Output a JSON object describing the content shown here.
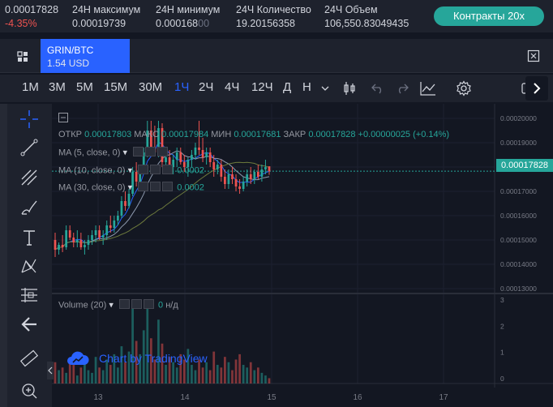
{
  "ticker": {
    "last_price": "0.00017828",
    "change_pct": "-4.35%",
    "high_label": "24Н максимум",
    "high_value": "0.00019739",
    "low_label": "24Н минимум",
    "low_value_main": "0.000168",
    "low_value_faded": "00",
    "count_label": "24Ч Количество",
    "count_value": "19.20156358",
    "volume_label": "24Ч Объем",
    "volume_value": "106,550.83049435",
    "contracts_button": "Контракты 20x"
  },
  "symbol": {
    "name": "GRIN/BTC",
    "price": "1.54 USD"
  },
  "toolbar": {
    "timeframes": [
      "1M",
      "3M",
      "5M",
      "15M",
      "30M",
      "1Ч",
      "2Ч",
      "4Ч",
      "12Ч",
      "Д",
      "Н"
    ],
    "active_timeframe": "1Ч"
  },
  "legend": {
    "open_label": "ОТКР",
    "open_value": "0.00017803",
    "high_label": "МАКС",
    "high_value": "0.00017984",
    "low_label": "МИН",
    "low_value": "0.00017681",
    "close_label": "ЗАКР",
    "close_value": "0.00017828",
    "change": "+0.00000025 (+0.14%)",
    "ma5": "MA (5, close, 0)",
    "ma10": "MA (10, close, 0)",
    "ma10_value": "0.0002",
    "ma30": "MA (30, close, 0)",
    "ma30_value": "0.0002",
    "volume": "Volume (20)",
    "volume_value": "0",
    "volume_na": "н/д"
  },
  "price_axis": {
    "labels": [
      "0.00020000",
      "0.00019000",
      "0.00018000",
      "0.00017000",
      "0.00016000",
      "0.00015000",
      "0.00014000",
      "0.00013000"
    ],
    "current_price_tag": "0.00017828"
  },
  "volume_axis": {
    "labels": [
      "3",
      "2",
      "1",
      "0"
    ]
  },
  "time_axis": {
    "labels": [
      "13",
      "14",
      "15",
      "16",
      "17"
    ]
  },
  "watermark": "Chart by TradingView",
  "colors": {
    "bg": "#131722",
    "panel": "#1e222d",
    "up": "#26a69a",
    "down": "#ef5350",
    "accent": "#2962ff",
    "ma5": "#2962ff",
    "ma10": "#8e9aaf",
    "ma30": "#6d7a3d"
  },
  "chart_data": {
    "type": "candlestick",
    "x_axis_label_values": [
      "13",
      "14",
      "15",
      "16",
      "17"
    ],
    "ylim": [
      0.000128,
      0.000206
    ],
    "candles": [
      {
        "o": 0.00015,
        "h": 0.000153,
        "l": 0.000143,
        "c": 0.000146
      },
      {
        "o": 0.000146,
        "h": 0.000149,
        "l": 0.000144,
        "c": 0.000148
      },
      {
        "o": 0.000148,
        "h": 0.000152,
        "l": 0.000145,
        "c": 0.000147
      },
      {
        "o": 0.000147,
        "h": 0.000156,
        "l": 0.000146,
        "c": 0.000154
      },
      {
        "o": 0.000154,
        "h": 0.000156,
        "l": 0.00015,
        "c": 0.000151
      },
      {
        "o": 0.000151,
        "h": 0.000153,
        "l": 0.000147,
        "c": 0.000149
      },
      {
        "o": 0.000149,
        "h": 0.000154,
        "l": 0.000147,
        "c": 0.00015
      },
      {
        "o": 0.00015,
        "h": 0.000153,
        "l": 0.000146,
        "c": 0.000147
      },
      {
        "o": 0.000147,
        "h": 0.00015,
        "l": 0.000144,
        "c": 0.000148
      },
      {
        "o": 0.000148,
        "h": 0.000152,
        "l": 0.000146,
        "c": 0.00015
      },
      {
        "o": 0.00015,
        "h": 0.000154,
        "l": 0.000148,
        "c": 0.000152
      },
      {
        "o": 0.000152,
        "h": 0.000156,
        "l": 0.000149,
        "c": 0.000154
      },
      {
        "o": 0.000154,
        "h": 0.000156,
        "l": 0.00015,
        "c": 0.000151
      },
      {
        "o": 0.000151,
        "h": 0.000154,
        "l": 0.000148,
        "c": 0.000152
      },
      {
        "o": 0.000152,
        "h": 0.000158,
        "l": 0.00015,
        "c": 0.000156
      },
      {
        "o": 0.000156,
        "h": 0.00016,
        "l": 0.000153,
        "c": 0.000155
      },
      {
        "o": 0.000155,
        "h": 0.00016,
        "l": 0.000153,
        "c": 0.000158
      },
      {
        "o": 0.000158,
        "h": 0.000162,
        "l": 0.000156,
        "c": 0.00016
      },
      {
        "o": 0.00016,
        "h": 0.000168,
        "l": 0.000159,
        "c": 0.000166
      },
      {
        "o": 0.000166,
        "h": 0.00017,
        "l": 0.000162,
        "c": 0.000164
      },
      {
        "o": 0.000164,
        "h": 0.000171,
        "l": 0.000163,
        "c": 0.000169
      },
      {
        "o": 0.000169,
        "h": 0.00018,
        "l": 0.000168,
        "c": 0.000178
      },
      {
        "o": 0.000178,
        "h": 0.000182,
        "l": 0.000172,
        "c": 0.000174
      },
      {
        "o": 0.000174,
        "h": 0.00018,
        "l": 0.000173,
        "c": 0.000179
      },
      {
        "o": 0.000179,
        "h": 0.000188,
        "l": 0.000177,
        "c": 0.000186
      },
      {
        "o": 0.000186,
        "h": 0.000199,
        "l": 0.000184,
        "c": 0.000195
      },
      {
        "o": 0.000195,
        "h": 0.000199,
        "l": 0.000186,
        "c": 0.000188
      },
      {
        "o": 0.000188,
        "h": 0.000197,
        "l": 0.000185,
        "c": 0.000186
      },
      {
        "o": 0.000186,
        "h": 0.000199,
        "l": 0.000184,
        "c": 0.000196
      },
      {
        "o": 0.000196,
        "h": 0.000198,
        "l": 0.00018,
        "c": 0.000182
      },
      {
        "o": 0.000182,
        "h": 0.000186,
        "l": 0.000179,
        "c": 0.000184
      },
      {
        "o": 0.000184,
        "h": 0.000187,
        "l": 0.000178,
        "c": 0.00018
      },
      {
        "o": 0.00018,
        "h": 0.000185,
        "l": 0.000177,
        "c": 0.000183
      },
      {
        "o": 0.000183,
        "h": 0.000188,
        "l": 0.00018,
        "c": 0.000186
      },
      {
        "o": 0.000186,
        "h": 0.000188,
        "l": 0.000181,
        "c": 0.000182
      },
      {
        "o": 0.000182,
        "h": 0.000185,
        "l": 0.000178,
        "c": 0.00018
      },
      {
        "o": 0.00018,
        "h": 0.000184,
        "l": 0.000176,
        "c": 0.000183
      },
      {
        "o": 0.000183,
        "h": 0.000187,
        "l": 0.00018,
        "c": 0.000185
      },
      {
        "o": 0.000185,
        "h": 0.00019,
        "l": 0.000183,
        "c": 0.000188
      },
      {
        "o": 0.000188,
        "h": 0.000199,
        "l": 0.000185,
        "c": 0.000187
      },
      {
        "o": 0.000187,
        "h": 0.000192,
        "l": 0.000182,
        "c": 0.000184
      },
      {
        "o": 0.000184,
        "h": 0.000188,
        "l": 0.000181,
        "c": 0.000186
      },
      {
        "o": 0.000186,
        "h": 0.000188,
        "l": 0.00018,
        "c": 0.000182
      },
      {
        "o": 0.000182,
        "h": 0.000185,
        "l": 0.000176,
        "c": 0.000179
      },
      {
        "o": 0.000179,
        "h": 0.000183,
        "l": 0.000177,
        "c": 0.000181
      },
      {
        "o": 0.000181,
        "h": 0.000183,
        "l": 0.000174,
        "c": 0.000176
      },
      {
        "o": 0.000176,
        "h": 0.000179,
        "l": 0.000171,
        "c": 0.000173
      },
      {
        "o": 0.000173,
        "h": 0.000179,
        "l": 0.000171,
        "c": 0.000177
      },
      {
        "o": 0.000177,
        "h": 0.00018,
        "l": 0.000173,
        "c": 0.000175
      },
      {
        "o": 0.000175,
        "h": 0.000177,
        "l": 0.00017,
        "c": 0.000172
      },
      {
        "o": 0.000172,
        "h": 0.000175,
        "l": 0.000169,
        "c": 0.000171
      },
      {
        "o": 0.000171,
        "h": 0.000176,
        "l": 0.00017,
        "c": 0.000174
      },
      {
        "o": 0.000174,
        "h": 0.000179,
        "l": 0.000172,
        "c": 0.000177
      },
      {
        "o": 0.000177,
        "h": 0.00018,
        "l": 0.000173,
        "c": 0.000175
      },
      {
        "o": 0.000175,
        "h": 0.000179,
        "l": 0.000173,
        "c": 0.000178
      },
      {
        "o": 0.000178,
        "h": 0.000181,
        "l": 0.000175,
        "c": 0.000176
      },
      {
        "o": 0.000176,
        "h": 0.000181,
        "l": 0.000174,
        "c": 0.000179
      },
      {
        "o": 0.000179,
        "h": 0.000183,
        "l": 0.000177,
        "c": 0.00018
      },
      {
        "o": 0.0001803,
        "h": 0.0001798,
        "l": 0.0001768,
        "c": 0.0001783
      }
    ],
    "volume": [
      0.8,
      0.5,
      0.6,
      0.4,
      0.9,
      0.7,
      0.3,
      0.6,
      0.8,
      0.5,
      0.4,
      1.0,
      0.6,
      0.5,
      0.9,
      0.7,
      1.1,
      0.6,
      1.4,
      0.8,
      1.2,
      2.9,
      1.6,
      1.1,
      2.0,
      3.0,
      1.7,
      0.9,
      2.4,
      1.5,
      0.7,
      1.0,
      0.8,
      0.6,
      1.1,
      0.9,
      1.3,
      0.7,
      0.5,
      0.9,
      0.6,
      0.8,
      0.5,
      1.2,
      0.7,
      0.6,
      1.0,
      0.8,
      0.5,
      0.9,
      1.1,
      0.7,
      0.6,
      0.8,
      0.5,
      0.6,
      0.4,
      0.3,
      0.2
    ]
  }
}
